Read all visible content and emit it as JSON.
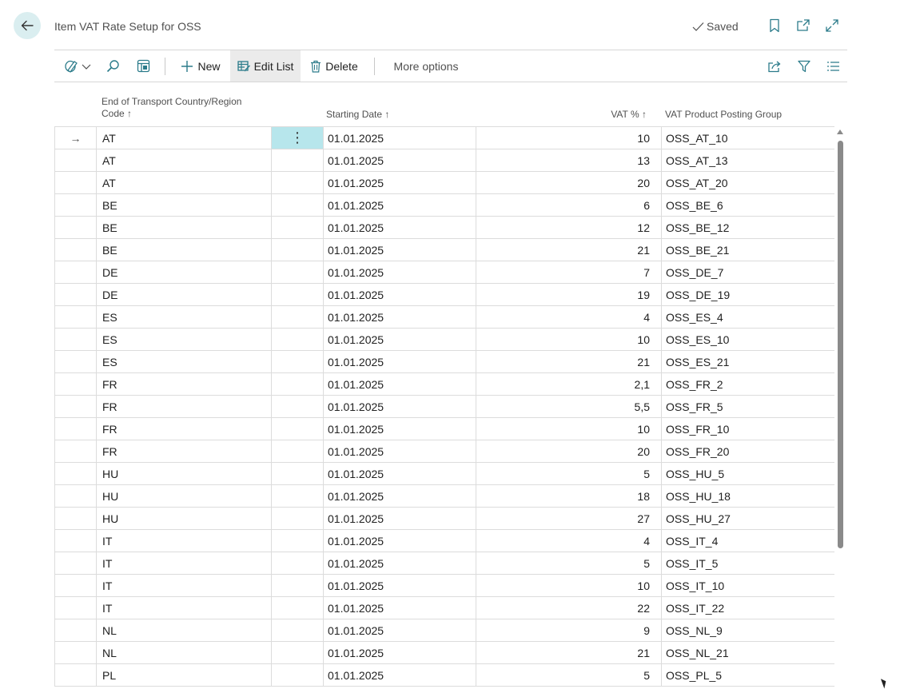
{
  "header": {
    "title": "Item VAT Rate Setup for OSS",
    "saved_label": "Saved",
    "icons": [
      "back-arrow-icon",
      "checkmark-icon",
      "bookmark-icon",
      "open-new-window-icon",
      "expand-icon"
    ]
  },
  "actions": {
    "new_label": "New",
    "edit_list_label": "Edit List",
    "delete_label": "Delete",
    "more_options_label": "More options",
    "icons": [
      "personalize-icon",
      "chevron-down-icon",
      "search-icon",
      "page-layout-icon",
      "plus-icon",
      "edit-list-icon",
      "trash-icon",
      "share-icon",
      "filter-icon",
      "list-view-icon"
    ]
  },
  "columns": {
    "country_line1": "End of Transport Country/Region",
    "country_line2": "Code",
    "starting_date": "Starting Date",
    "vat_pct": "VAT %",
    "posting_group": "VAT Product Posting Group",
    "sort_glyph": "↑"
  },
  "rows": [
    {
      "code": "AT",
      "date": "01.01.2025",
      "vat": "10",
      "group": "OSS_AT_10"
    },
    {
      "code": "AT",
      "date": "01.01.2025",
      "vat": "13",
      "group": "OSS_AT_13"
    },
    {
      "code": "AT",
      "date": "01.01.2025",
      "vat": "20",
      "group": "OSS_AT_20"
    },
    {
      "code": "BE",
      "date": "01.01.2025",
      "vat": "6",
      "group": "OSS_BE_6"
    },
    {
      "code": "BE",
      "date": "01.01.2025",
      "vat": "12",
      "group": "OSS_BE_12"
    },
    {
      "code": "BE",
      "date": "01.01.2025",
      "vat": "21",
      "group": "OSS_BE_21"
    },
    {
      "code": "DE",
      "date": "01.01.2025",
      "vat": "7",
      "group": "OSS_DE_7"
    },
    {
      "code": "DE",
      "date": "01.01.2025",
      "vat": "19",
      "group": "OSS_DE_19"
    },
    {
      "code": "ES",
      "date": "01.01.2025",
      "vat": "4",
      "group": "OSS_ES_4"
    },
    {
      "code": "ES",
      "date": "01.01.2025",
      "vat": "10",
      "group": "OSS_ES_10"
    },
    {
      "code": "ES",
      "date": "01.01.2025",
      "vat": "21",
      "group": "OSS_ES_21"
    },
    {
      "code": "FR",
      "date": "01.01.2025",
      "vat": "2,1",
      "group": "OSS_FR_2"
    },
    {
      "code": "FR",
      "date": "01.01.2025",
      "vat": "5,5",
      "group": "OSS_FR_5"
    },
    {
      "code": "FR",
      "date": "01.01.2025",
      "vat": "10",
      "group": "OSS_FR_10"
    },
    {
      "code": "FR",
      "date": "01.01.2025",
      "vat": "20",
      "group": "OSS_FR_20"
    },
    {
      "code": "HU",
      "date": "01.01.2025",
      "vat": "5",
      "group": "OSS_HU_5"
    },
    {
      "code": "HU",
      "date": "01.01.2025",
      "vat": "18",
      "group": "OSS_HU_18"
    },
    {
      "code": "HU",
      "date": "01.01.2025",
      "vat": "27",
      "group": "OSS_HU_27"
    },
    {
      "code": "IT",
      "date": "01.01.2025",
      "vat": "4",
      "group": "OSS_IT_4"
    },
    {
      "code": "IT",
      "date": "01.01.2025",
      "vat": "5",
      "group": "OSS_IT_5"
    },
    {
      "code": "IT",
      "date": "01.01.2025",
      "vat": "10",
      "group": "OSS_IT_10"
    },
    {
      "code": "IT",
      "date": "01.01.2025",
      "vat": "22",
      "group": "OSS_IT_22"
    },
    {
      "code": "NL",
      "date": "01.01.2025",
      "vat": "9",
      "group": "OSS_NL_9"
    },
    {
      "code": "NL",
      "date": "01.01.2025",
      "vat": "21",
      "group": "OSS_NL_21"
    },
    {
      "code": "PL",
      "date": "01.01.2025",
      "vat": "5",
      "group": "OSS_PL_5"
    }
  ],
  "selected_row_index": 0,
  "row_indicator": "→",
  "row_menu_glyph": "⋮",
  "colors": {
    "accent_teal": "#b7e6ec",
    "back_button_bg": "#daeef0",
    "toolbar_active_bg": "#ebebeb"
  }
}
